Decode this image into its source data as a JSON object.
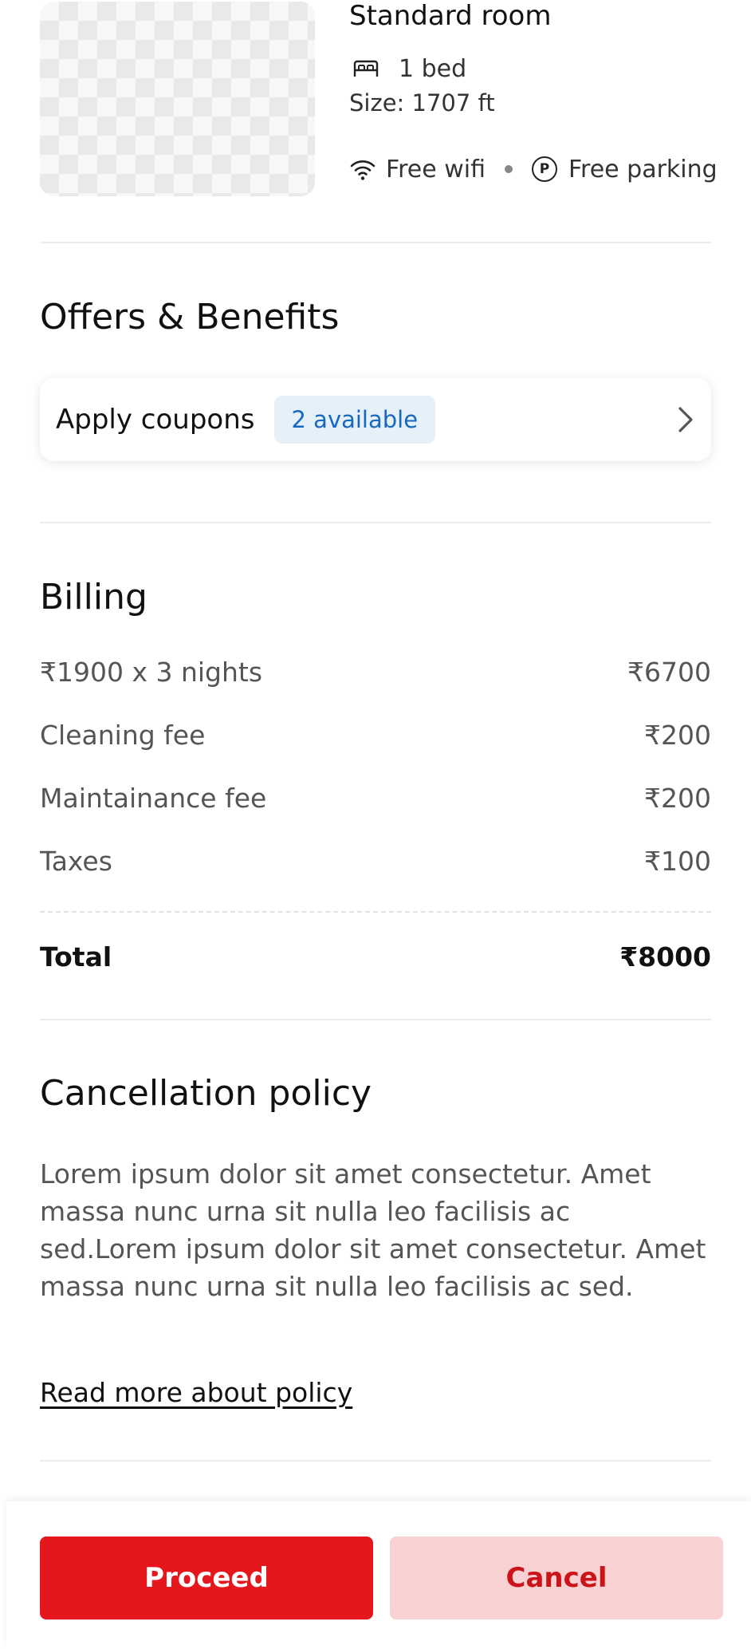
{
  "room": {
    "title": "Standard room",
    "beds": "1 bed",
    "size": "Size: 1707 ft",
    "amenities": [
      {
        "icon": "wifi-icon",
        "label": "Free wifi"
      },
      {
        "icon": "parking-icon",
        "label": "Free parking",
        "glyph": "P"
      }
    ]
  },
  "offers": {
    "title": "Offers & Benefits",
    "coupon_label": "Apply coupons",
    "coupon_badge": "2 available"
  },
  "billing": {
    "title": "Billing",
    "rows": [
      {
        "label": "₹1900 x 3 nights",
        "amount": "₹6700"
      },
      {
        "label": "Cleaning fee",
        "amount": "₹200"
      },
      {
        "label": "Maintainance fee",
        "amount": "₹200"
      },
      {
        "label": "Taxes",
        "amount": "₹100"
      }
    ],
    "total_label": "Total",
    "total_amount": "₹8000"
  },
  "policy": {
    "title": "Cancellation policy",
    "text": "Lorem ipsum dolor sit amet consectetur. Amet massa nunc urna sit nulla leo facilisis ac sed.Lorem ipsum dolor sit amet consectetur. Amet massa nunc urna sit nulla leo facilisis ac sed.",
    "link": "Read more about policy"
  },
  "actions": {
    "proceed": "Proceed",
    "cancel": "Cancel"
  },
  "colors": {
    "primary": "#e5171c",
    "primary_light": "#f8d2d3",
    "badge_bg": "#e6f0f9",
    "badge_text": "#1769c0"
  }
}
